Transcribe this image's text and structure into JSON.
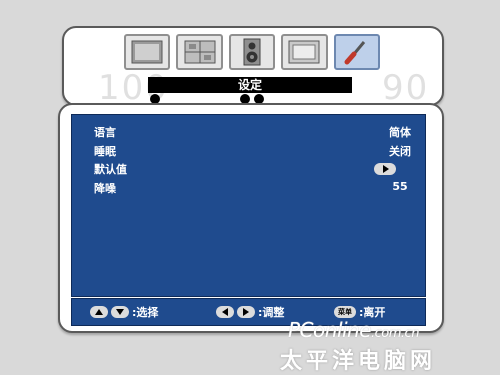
{
  "header": {
    "title": "设定",
    "ghost_left": "100",
    "ghost_right": "90",
    "tabs": [
      {
        "name": "picture-tab"
      },
      {
        "name": "display-tab"
      },
      {
        "name": "audio-tab"
      },
      {
        "name": "screen-tab"
      },
      {
        "name": "setup-tab",
        "active": true
      }
    ]
  },
  "settings": {
    "language": {
      "label": "语言",
      "value": "简体"
    },
    "sleep": {
      "label": "睡眠",
      "value": "关闭"
    },
    "default": {
      "label": "默认值"
    },
    "noise_reduction": {
      "label": "降噪",
      "value": "55"
    }
  },
  "footer": {
    "select_label": ":选择",
    "adjust_label": ":调整",
    "menu_key": "菜单",
    "exit_label": ":离开"
  },
  "watermark": {
    "line1": "PConline",
    "line1_suffix": ".com.cn",
    "line2": "太平洋电脑网"
  },
  "colors": {
    "panel": "#1f4b8e",
    "active_tab": "#bed0ea"
  }
}
